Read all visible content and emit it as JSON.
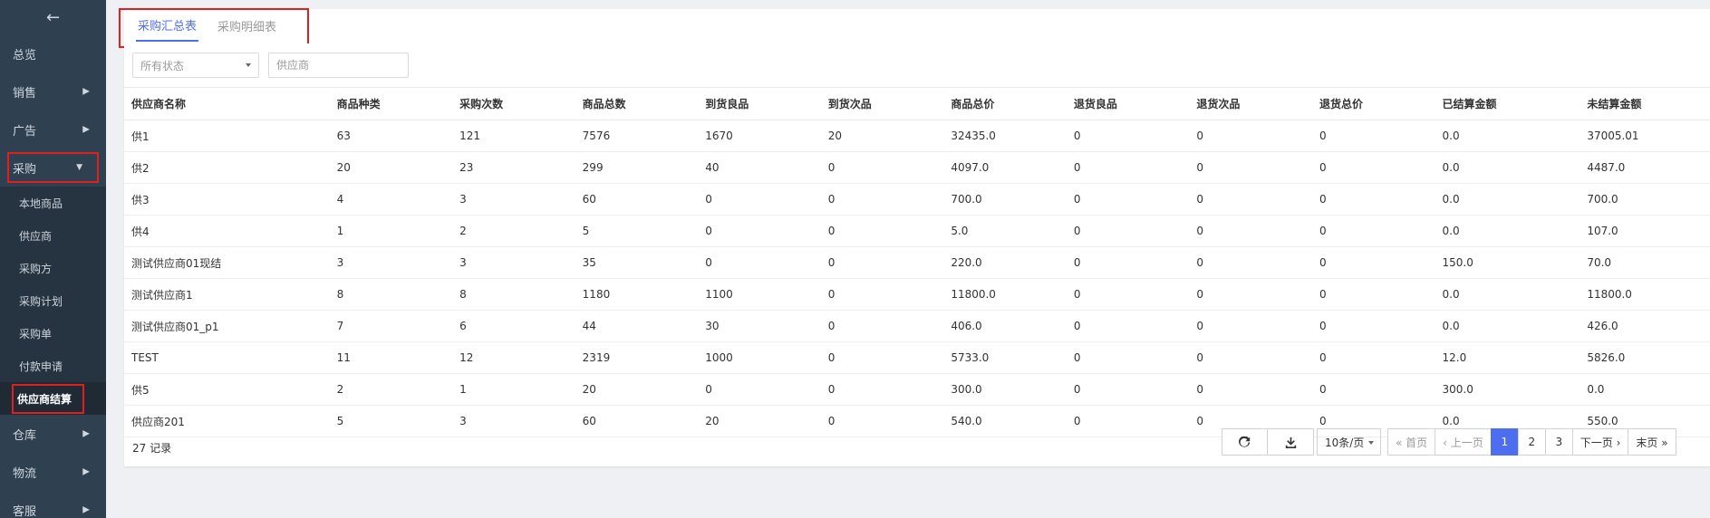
{
  "sidebar": {
    "back_icon": "←",
    "items": [
      {
        "label": "总览"
      },
      {
        "label": "销售"
      },
      {
        "label": "广告"
      },
      {
        "label": "采购"
      },
      {
        "label": "仓库"
      },
      {
        "label": "物流"
      },
      {
        "label": "客服"
      }
    ],
    "sub_items": [
      {
        "label": "本地商品"
      },
      {
        "label": "供应商"
      },
      {
        "label": "采购方"
      },
      {
        "label": "采购计划"
      },
      {
        "label": "采购单"
      },
      {
        "label": "付款申请"
      },
      {
        "label": "供应商结算"
      }
    ]
  },
  "tabs": [
    {
      "label": "采购汇总表"
    },
    {
      "label": "采购明细表"
    }
  ],
  "filters": {
    "status_select": "所有状态",
    "supplier_placeholder": "供应商"
  },
  "table": {
    "headers": [
      "供应商名称",
      "商品种类",
      "采购次数",
      "商品总数",
      "到货良品",
      "到货次品",
      "商品总价",
      "退货良品",
      "退货次品",
      "退货总价",
      "已结算金额",
      "未结算金额"
    ],
    "rows": [
      [
        "供1",
        "63",
        "121",
        "7576",
        "1670",
        "20",
        "32435.0",
        "0",
        "0",
        "0",
        "0.0",
        "37005.01"
      ],
      [
        "供2",
        "20",
        "23",
        "299",
        "40",
        "0",
        "4097.0",
        "0",
        "0",
        "0",
        "0.0",
        "4487.0"
      ],
      [
        "供3",
        "4",
        "3",
        "60",
        "0",
        "0",
        "700.0",
        "0",
        "0",
        "0",
        "0.0",
        "700.0"
      ],
      [
        "供4",
        "1",
        "2",
        "5",
        "0",
        "0",
        "5.0",
        "0",
        "0",
        "0",
        "0.0",
        "107.0"
      ],
      [
        "测试供应商01现结",
        "3",
        "3",
        "35",
        "0",
        "0",
        "220.0",
        "0",
        "0",
        "0",
        "150.0",
        "70.0"
      ],
      [
        "测试供应商1",
        "8",
        "8",
        "1180",
        "1100",
        "0",
        "11800.0",
        "0",
        "0",
        "0",
        "0.0",
        "11800.0"
      ],
      [
        "测试供应商01_p1",
        "7",
        "6",
        "44",
        "30",
        "0",
        "406.0",
        "0",
        "0",
        "0",
        "0.0",
        "426.0"
      ],
      [
        "TEST",
        "11",
        "12",
        "2319",
        "1000",
        "0",
        "5733.0",
        "0",
        "0",
        "0",
        "12.0",
        "5826.0"
      ],
      [
        "供5",
        "2",
        "1",
        "20",
        "0",
        "0",
        "300.0",
        "0",
        "0",
        "0",
        "300.0",
        "0.0"
      ],
      [
        "供应商201",
        "5",
        "3",
        "60",
        "20",
        "0",
        "540.0",
        "0",
        "0",
        "0",
        "0.0",
        "550.0"
      ]
    ]
  },
  "footer": {
    "records": "27 记录",
    "page_size": "10条/页",
    "first": "« 首页",
    "prev": "‹ 上一页",
    "pages": [
      "1",
      "2",
      "3"
    ],
    "next": "下一页 ›",
    "last": "末页 »"
  },
  "colors": {
    "accent": "#4e6ef2",
    "sidebar_bg": "#2f4050",
    "highlight_box": "#e02020"
  }
}
